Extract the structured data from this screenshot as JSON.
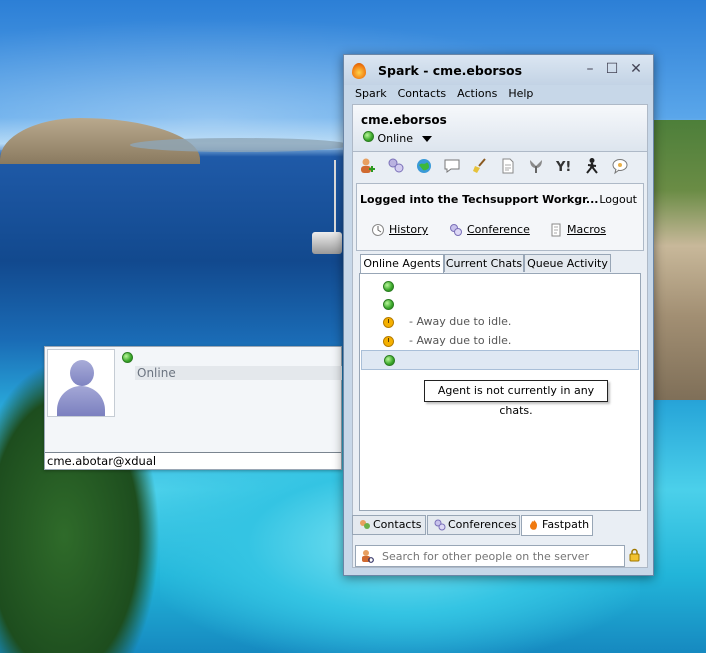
{
  "desktop": {},
  "profile_card": {
    "status": "Online",
    "email": "cme.abotar@xdual"
  },
  "window": {
    "title": "Spark - cme.eborsos",
    "controls": {
      "minimize": "–",
      "maximize": "☐",
      "close": "✕"
    },
    "menu": [
      "Spark",
      "Contacts",
      "Actions",
      "Help"
    ],
    "user": {
      "name": "cme.eborsos",
      "presence": "Online"
    },
    "toolbar_icons": [
      "add-contact-icon",
      "conference-icon",
      "globe-icon",
      "chat-icon",
      "broom-icon",
      "document-icon",
      "msn-icon",
      "yahoo-icon",
      "aim-icon",
      "icq-icon"
    ],
    "fastpath": {
      "logged_text": "Logged into the Techsupport Workgr...",
      "logout": "Logout",
      "actions": [
        "History",
        "Conference",
        "Macros"
      ]
    },
    "tabs": [
      "Online Agents",
      "Current Chats",
      "Queue Activity"
    ],
    "agents": [
      {
        "status": "online",
        "text": ""
      },
      {
        "status": "online",
        "text": ""
      },
      {
        "status": "away",
        "text": "- Away due to idle."
      },
      {
        "status": "away",
        "text": "- Away due to idle."
      },
      {
        "status": "online",
        "text": ""
      }
    ],
    "tooltip": "Agent is not currently in any chats.",
    "bottom_tabs": [
      "Contacts",
      "Conferences",
      "Fastpath"
    ],
    "search_placeholder": "Search for other people on the server"
  }
}
